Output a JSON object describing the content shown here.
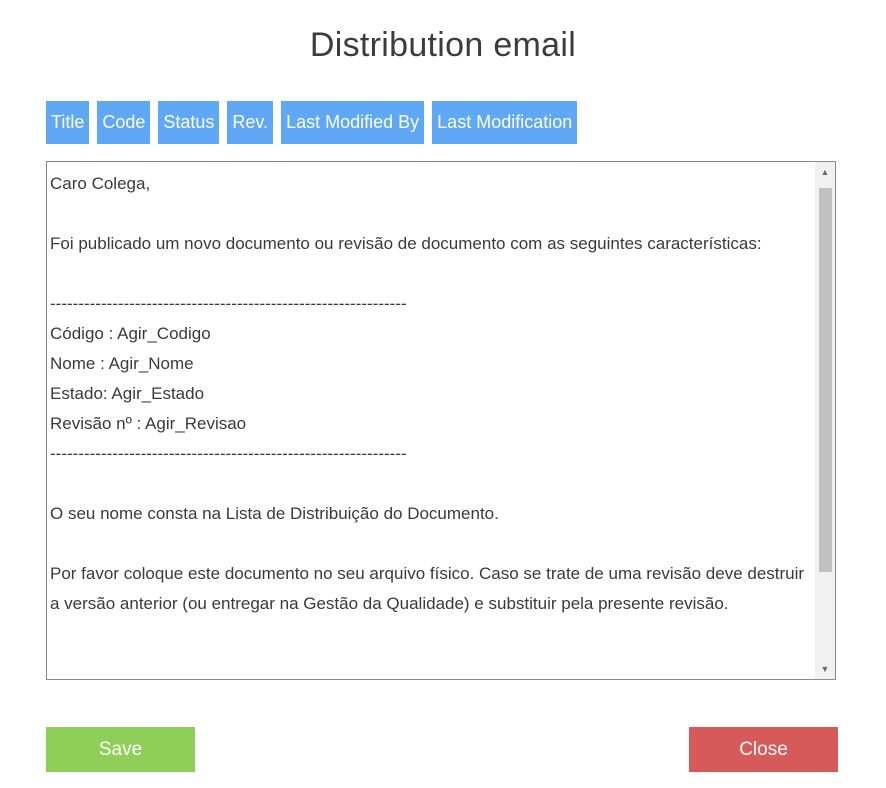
{
  "dialog": {
    "title": "Distribution email"
  },
  "tags": [
    {
      "label": "Title"
    },
    {
      "label": "Code"
    },
    {
      "label": "Status"
    },
    {
      "label": "Rev."
    },
    {
      "label": "Last Modified By"
    },
    {
      "label": "Last Modification"
    }
  ],
  "editor": {
    "body": "Caro Colega,\n\nFoi publicado um novo documento ou revisão de documento com as seguintes características:\n\n---------------------------------------------------------------\nCódigo : Agir_Codigo\nNome : Agir_Nome\nEstado: Agir_Estado\nRevisão nº : Agir_Revisao\n---------------------------------------------------------------\n\nO seu nome consta na Lista de Distribuição do Documento.\n\nPor favor coloque este documento no seu arquivo físico. Caso se trate de uma revisão deve destruir a versão anterior (ou entregar na Gestão da Qualidade) e substituir pela presente revisão.",
    "scroll_position": 0.0
  },
  "buttons": {
    "save_label": "Save",
    "close_label": "Close"
  },
  "colors": {
    "tag_bg": "#5fa8f5",
    "save_bg": "#8fce58",
    "close_bg": "#d75a5a"
  },
  "icons": {
    "scroll_up": "triangle-up",
    "scroll_down": "triangle-down"
  }
}
